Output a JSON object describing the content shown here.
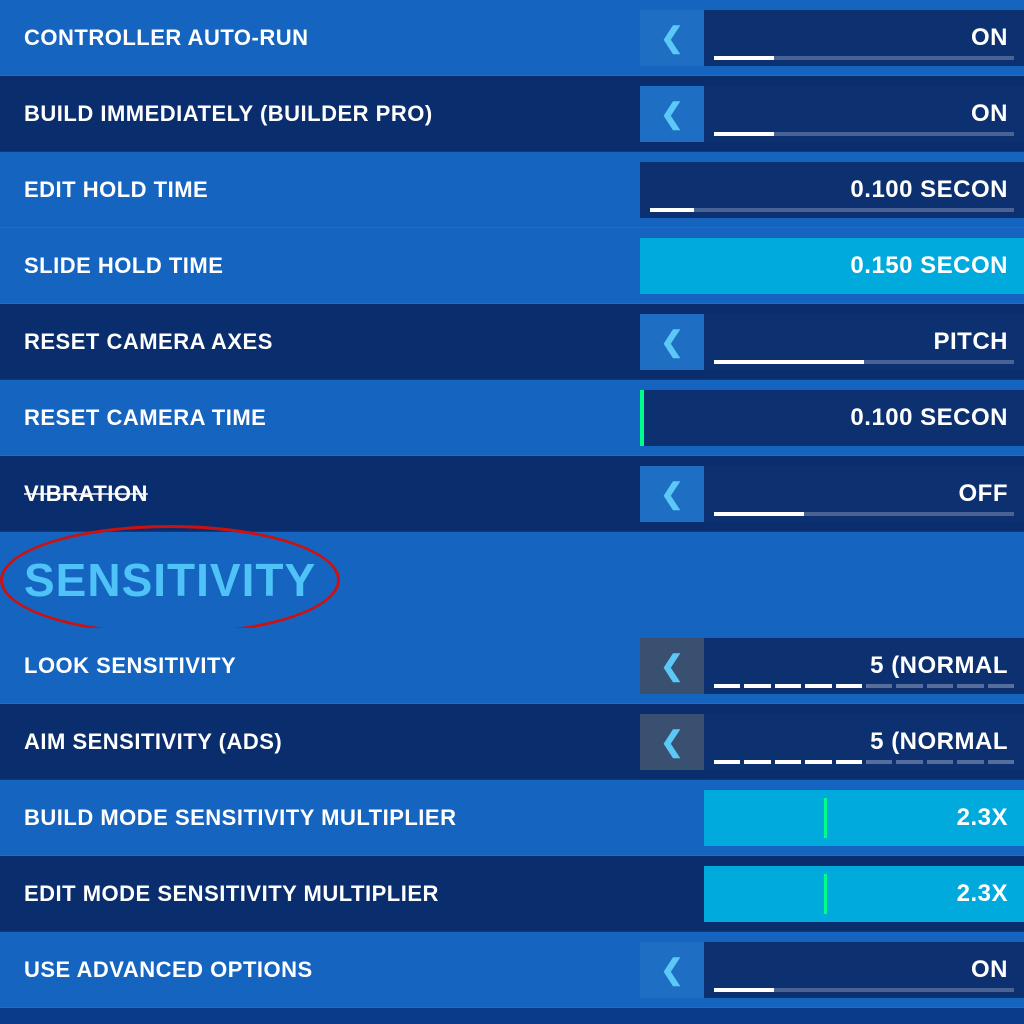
{
  "settings": {
    "rows": [
      {
        "id": "controller-auto-run",
        "label": "CONTROLLER AUTO-RUN",
        "hasArrow": true,
        "arrowDark": false,
        "value": "ON",
        "valueBg": "dark",
        "barPercent": 20,
        "rowBg": "normal",
        "isCyan": false,
        "strikethrough": false
      },
      {
        "id": "build-immediately",
        "label": "BUILD IMMEDIATELY (BUILDER PRO)",
        "hasArrow": true,
        "arrowDark": false,
        "value": "ON",
        "valueBg": "dark",
        "barPercent": 20,
        "rowBg": "dark",
        "isCyan": false,
        "strikethrough": false
      },
      {
        "id": "edit-hold-time",
        "label": "EDIT HOLD TIME",
        "hasArrow": false,
        "value": "0.100 Secon",
        "valueBg": "dark",
        "barPercent": 15,
        "rowBg": "normal",
        "isCyan": false,
        "strikethrough": false
      },
      {
        "id": "slide-hold-time",
        "label": "SLIDE HOLD TIME",
        "hasArrow": false,
        "value": "0.150 Secon",
        "valueBg": "cyan",
        "barPercent": 0,
        "rowBg": "slide",
        "isCyan": true,
        "strikethrough": false
      },
      {
        "id": "reset-camera-axes",
        "label": "RESET CAMERA AXES",
        "hasArrow": true,
        "arrowDark": false,
        "value": "PITCH",
        "valueBg": "dark",
        "barPercent": 50,
        "rowBg": "dark",
        "isCyan": false,
        "strikethrough": false
      },
      {
        "id": "reset-camera-time",
        "label": "RESET CAMERA TIME",
        "hasArrow": false,
        "value": "0.100 Secon",
        "valueBg": "dark",
        "barPercent": 0,
        "rowBg": "normal",
        "isCyan": false,
        "strikethrough": false,
        "greenLeft": true
      },
      {
        "id": "vibration",
        "label": "VIBRATION",
        "hasArrow": true,
        "arrowDark": false,
        "value": "OFF",
        "valueBg": "dark",
        "barPercent": 30,
        "rowBg": "vibration",
        "isCyan": false,
        "strikethrough": true
      }
    ],
    "sensitivity_section": {
      "title": "SENSITIVITY"
    },
    "sensitivity_rows": [
      {
        "id": "look-sensitivity",
        "label": "LOOK SENSITIVITY",
        "hasArrow": true,
        "arrowDark": true,
        "value": "5 (NORMAL",
        "valueBg": "dark",
        "rowBg": "dark",
        "dashed": true,
        "activeSegment": 5
      },
      {
        "id": "aim-sensitivity",
        "label": "AIM SENSITIVITY (ADS)",
        "hasArrow": true,
        "arrowDark": true,
        "value": "5 (NORMAL",
        "valueBg": "dark",
        "rowBg": "normal",
        "dashed": true,
        "activeSegment": 5
      },
      {
        "id": "build-mode-multiplier",
        "label": "BUILD MODE SENSITIVITY MULTIPLIER",
        "hasArrow": false,
        "value": "2.3x",
        "valueBg": "cyan",
        "rowBg": "dark",
        "slider": true
      },
      {
        "id": "edit-mode-multiplier",
        "label": "EDIT MODE SENSITIVITY MULTIPLIER",
        "hasArrow": false,
        "value": "2.3x",
        "valueBg": "cyan",
        "rowBg": "normal",
        "slider": true
      },
      {
        "id": "use-advanced-options",
        "label": "USE ADVANCED OPTIONS",
        "hasArrow": true,
        "arrowDark": false,
        "value": "ON",
        "valueBg": "dark",
        "rowBg": "dark",
        "barPercent": 20
      }
    ]
  },
  "icons": {
    "arrow_left": "❮"
  }
}
